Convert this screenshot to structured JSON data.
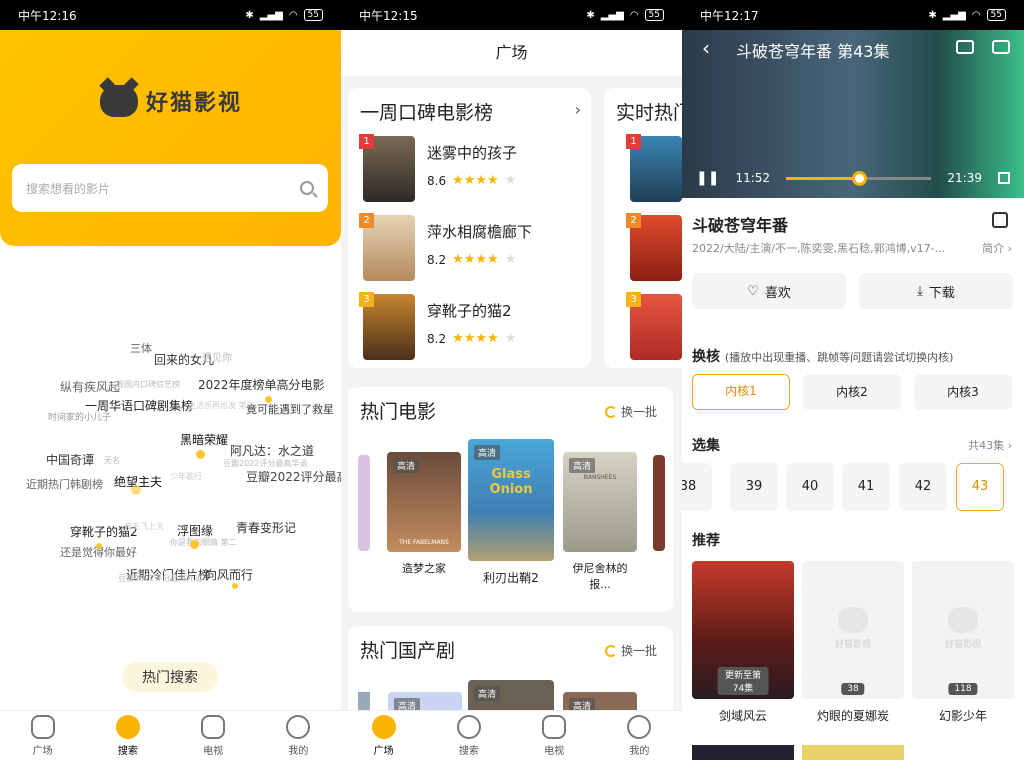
{
  "status": [
    {
      "time": "中午12:16",
      "batt": "55"
    },
    {
      "time": "中午12:15",
      "batt": "55"
    },
    {
      "time": "中午12:17",
      "batt": "55"
    }
  ],
  "nav": {
    "square": "广场",
    "search": "搜索",
    "tv": "电视",
    "mine": "我的"
  },
  "p1": {
    "brand": "好猫影视",
    "search_placeholder": "搜索想看的影片",
    "cloud": [
      "三体",
      "回来的女儿",
      "遇见你",
      "纵有疾风起",
      "周国内口碑综艺榜",
      "2022年度榜单高分电影",
      "一周华语口碑剧集榜",
      "生活乐再出发 第二",
      "竟可能遇到了救星",
      "时间家的小儿子",
      "黑暗荣耀",
      "中国奇谭",
      "阿凡达：水之道",
      "无名",
      "豆瓣2022评分最高华语",
      "近期热门韩剧榜",
      "绝望主夫",
      "少年歌行",
      "豆瓣2022评分最高",
      "穿靴子的猫2",
      "鸡毛飞上天",
      "浮图缘",
      "青春变形记",
      "还是觉得你最好",
      "你是我的眼睛 第二",
      "近期冷门佳片榜",
      "向风而行",
      "豆瓣2022评分最高外语"
    ],
    "hot_search": "热门搜索"
  },
  "p2": {
    "title": "广场",
    "rank_title": "一周口碑电影榜",
    "rank_more": "›",
    "rank2_title": "实时热门",
    "rank": [
      {
        "no": "1",
        "name": "迷雾中的孩子",
        "score": "8.6",
        "stars": 4
      },
      {
        "no": "2",
        "name": "萍水相腐檐廊下",
        "score": "8.2",
        "stars": 4
      },
      {
        "no": "3",
        "name": "穿靴子的猫2",
        "score": "8.2",
        "stars": 4
      }
    ],
    "rank2_nos": [
      "1",
      "2",
      "3"
    ],
    "hot_movies_title": "热门电影",
    "refresh": "换一批",
    "movies": [
      {
        "name": "造梦之家",
        "hd": "高清"
      },
      {
        "name": "利刃出鞘2",
        "hd": "高清"
      },
      {
        "name": "伊尼舍林的报...",
        "hd": "高清"
      }
    ],
    "poster_texts": [
      "THE FABELMANS",
      "Glass Onion",
      "BANSHEES"
    ],
    "hot_dramas_title": "热门国产剧",
    "drama_hd": "高清"
  },
  "p3": {
    "video_title": "斗破苍穹年番 第43集",
    "cur": "11:52",
    "total": "21:39",
    "progress": 0.5,
    "title": "斗破苍穹年番",
    "meta": "2022/大陆/主演/不一,陈奕雯,黑石稔,郭鸿博,v17-...",
    "intro": "简介 ›",
    "like": "喜欢",
    "download": "下载",
    "core_title": "换核",
    "core_hint": "(播放中出现重播、跳帧等问题请尝试切换内核)",
    "cores": [
      "内核1",
      "内核2",
      "内核3"
    ],
    "ep_title": "选集",
    "ep_total": "共43集 ›",
    "eps": [
      "38",
      "39",
      "40",
      "41",
      "42",
      "43"
    ],
    "rec_title": "推荐",
    "recs": [
      {
        "name": "剑域风云",
        "tag": "更新至第74集"
      },
      {
        "name": "灼眼的夏娜炭",
        "tag": "38"
      },
      {
        "name": "幻影少年",
        "tag": "118"
      }
    ],
    "ph_brand": "好猫影视"
  },
  "colors": {
    "accent": "#f8b400",
    "brand_yellow": "#ffc400"
  }
}
